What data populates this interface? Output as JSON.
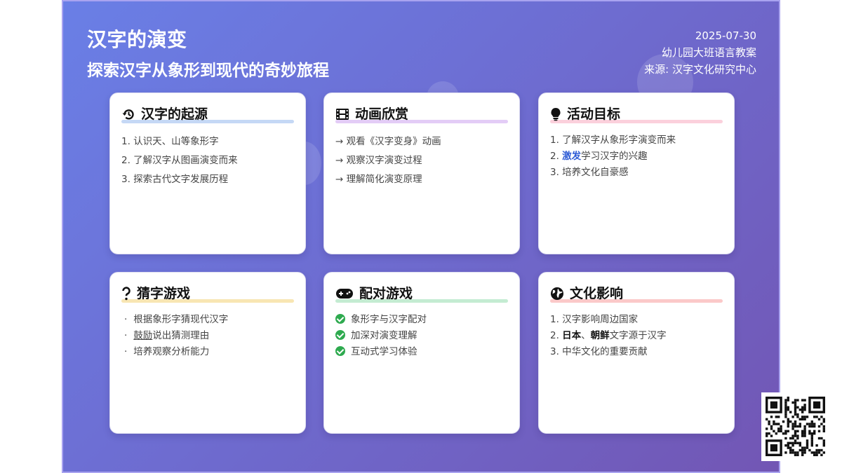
{
  "header": {
    "title": "汉字的演变",
    "subtitle": "探索汉字从象形到现代的奇妙旅程",
    "date": "2025-07-30",
    "course": "幼儿园大班语言教案",
    "source": "来源: 汉字文化研究中心"
  },
  "colors": {
    "background_start": "#6a7fe6",
    "background_end": "#7256b4",
    "underline_blue": "#c5d8f5",
    "underline_purple": "#e3ccf6",
    "underline_pink": "#fbd0dc",
    "underline_yellow": "#f8e6b3",
    "underline_green": "#c4ecd2",
    "underline_red": "#fbc9c9",
    "check_green": "#2eaa4f",
    "highlight_blue": "#2f5dd6"
  },
  "cards": [
    {
      "title": "汉字的起源",
      "icon": "history-icon",
      "items": [
        "1. 认识天、山等象形字",
        "2. 了解汉字从图画演变而来",
        "3. 探索古代文字发展历程"
      ]
    },
    {
      "title": "动画欣赏",
      "icon": "film-icon",
      "items": [
        "→ 观看《汉字变身》动画",
        "→ 观察汉字演变过程",
        "→ 理解简化演变原理"
      ]
    },
    {
      "title": "活动目标",
      "icon": "lightbulb-icon",
      "items": [
        "1. 了解汉字从象形字演变而来",
        {
          "prefix": "2. ",
          "highlight": "激发",
          "rest": "学习汉字的兴趣"
        },
        "3. 培养文化自豪感"
      ]
    },
    {
      "title": "猜字游戏",
      "icon": "question-icon",
      "bullet": "·",
      "items": [
        "根据象形字猜现代汉字",
        {
          "highlight": "鼓励",
          "rest": "说出猜测理由"
        },
        "培养观察分析能力"
      ]
    },
    {
      "title": "配对游戏",
      "icon": "gamepad-icon",
      "items": [
        "象形字与汉字配对",
        "加深对演变理解",
        "互动式学习体验"
      ]
    },
    {
      "title": "文化影响",
      "icon": "globe-icon",
      "items": [
        "1. 汉字影响周边国家",
        {
          "prefix": "2. ",
          "a": "日本",
          "sep": "、",
          "b": "朝鲜",
          "rest": "文字源于汉字"
        },
        "3. 中华文化的重要贡献"
      ]
    }
  ],
  "qr_code": {
    "icon": "qr-code-icon"
  }
}
